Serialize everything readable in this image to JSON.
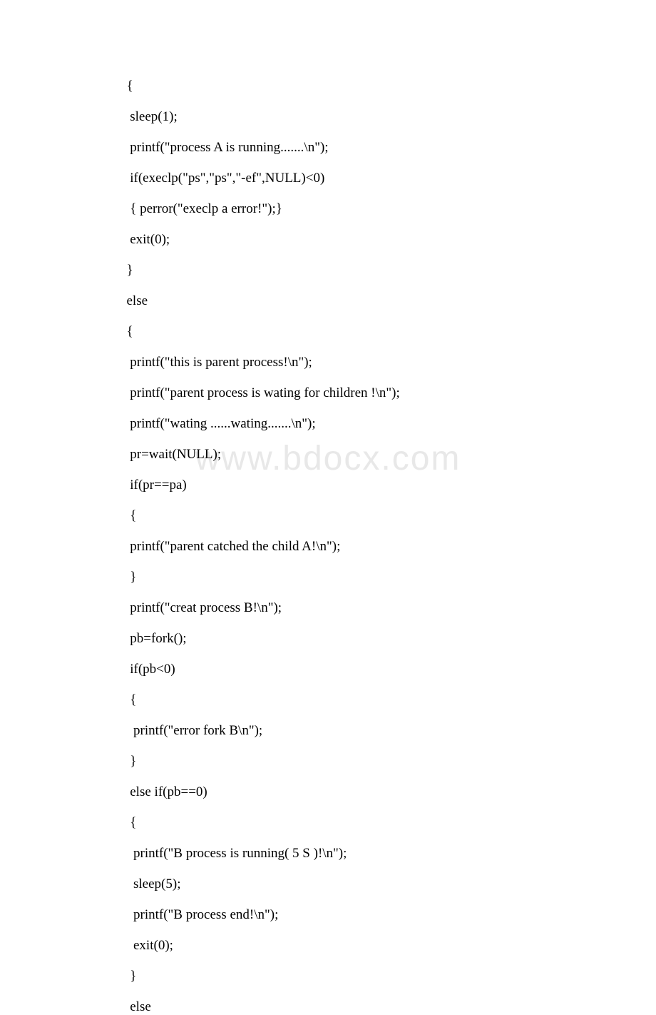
{
  "watermark": "www.bdocx.com",
  "code": {
    "lines": [
      "  {",
      "   sleep(1);",
      "   printf(\"process A is running.......\\n\");",
      "   if(execlp(\"ps\",\"ps\",\"-ef\",NULL)<0)",
      "   { perror(\"execlp a error!\");}",
      "   exit(0);",
      "  }",
      "  else",
      "  {",
      "   printf(\"this is parent process!\\n\");",
      "   printf(\"parent process is wating for children !\\n\");",
      "   printf(\"wating ......wating.......\\n\");",
      "   pr=wait(NULL);",
      "   if(pr==pa)",
      "   {",
      "   printf(\"parent catched the child A!\\n\");",
      "   }",
      "   printf(\"creat process B!\\n\");",
      "   pb=fork();",
      "   if(pb<0)",
      "   {",
      "    printf(\"error fork B\\n\");",
      "   }",
      "   else if(pb==0)",
      "   {",
      "    printf(\"B process is running( 5 S )!\\n\");",
      "    sleep(5);",
      "    printf(\"B process end!\\n\");",
      "    exit(0);",
      "   }",
      "   else"
    ]
  }
}
